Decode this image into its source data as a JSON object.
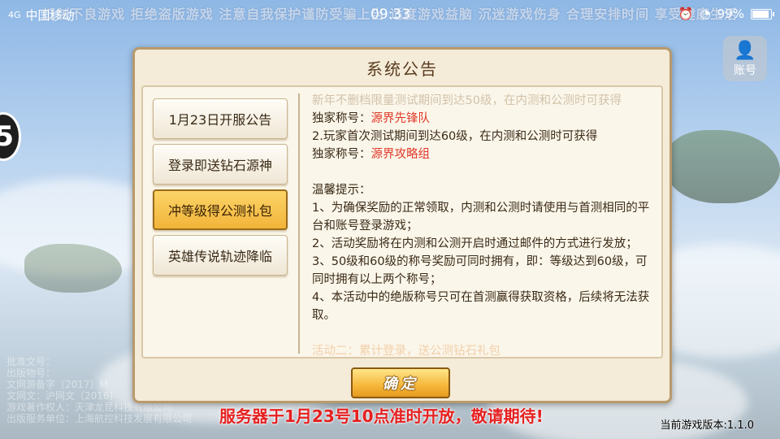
{
  "status_bar": {
    "carrier": "中国移动",
    "time": "09:33",
    "battery": "99%",
    "battery_level": 0.99,
    "signal_label": "4G"
  },
  "background": {
    "scroll_text": "抵制不良游戏 拒绝盗版游戏 注意自我保护谨防受骗上当 适度游戏益脑 沉迷游戏伤身 合理安排时间 享受健康生活",
    "info_lines": [
      "批准文号：",
      "出版物号：",
      "文网游备字〔2017〕M",
      "文网文：沪网文〔2016〕",
      "游戏著作权人：天津龙昆科技有限公司",
      "出版服务单位：上海航控科技发展有限公司"
    ]
  },
  "account_button": {
    "label": "账号",
    "icon": "user-icon"
  },
  "left_badge": {
    "text": "5"
  },
  "dialog": {
    "title": "系统公告",
    "tabs": [
      {
        "label": "1月23日开服公告",
        "active": false
      },
      {
        "label": "登录即送钻石源神",
        "active": false
      },
      {
        "label": "冲等级得公测礼包",
        "active": true
      },
      {
        "label": "英雄传说轨迹降临",
        "active": false
      }
    ],
    "content": {
      "top_faded": "新年不删档限量测试期间到达50级，在内测和公测时可获得",
      "line1_prefix": "独家称号：",
      "line1_title": "源界先锋队",
      "line2": "2.玩家首次测试期间到达60级，在内测和公测时可获得",
      "line3_prefix": "独家称号：",
      "line3_title": "源界攻略组",
      "tips_heading": "温馨提示：",
      "tips": [
        "1、为确保奖励的正常领取，内测和公测时请使用与首测相同的平台和账号登录游戏；",
        "2、活动奖励将在内测和公测开启时通过邮件的方式进行发放；",
        "3、50级和60级的称号奖励可同时拥有，即：等级达到60级，可同时拥有以上两个称号；",
        "4、本活动中的绝版称号只可在首测赢得获取资格，后续将无法获取。"
      ],
      "bottom_faded": "活动二：累计登录，送公测钻石礼包"
    },
    "confirm_label": "确定"
  },
  "server_notice": "服务器于1月23号10点准时开放，敬请期待!",
  "version_text": "当前游戏版本:1.1.0"
}
